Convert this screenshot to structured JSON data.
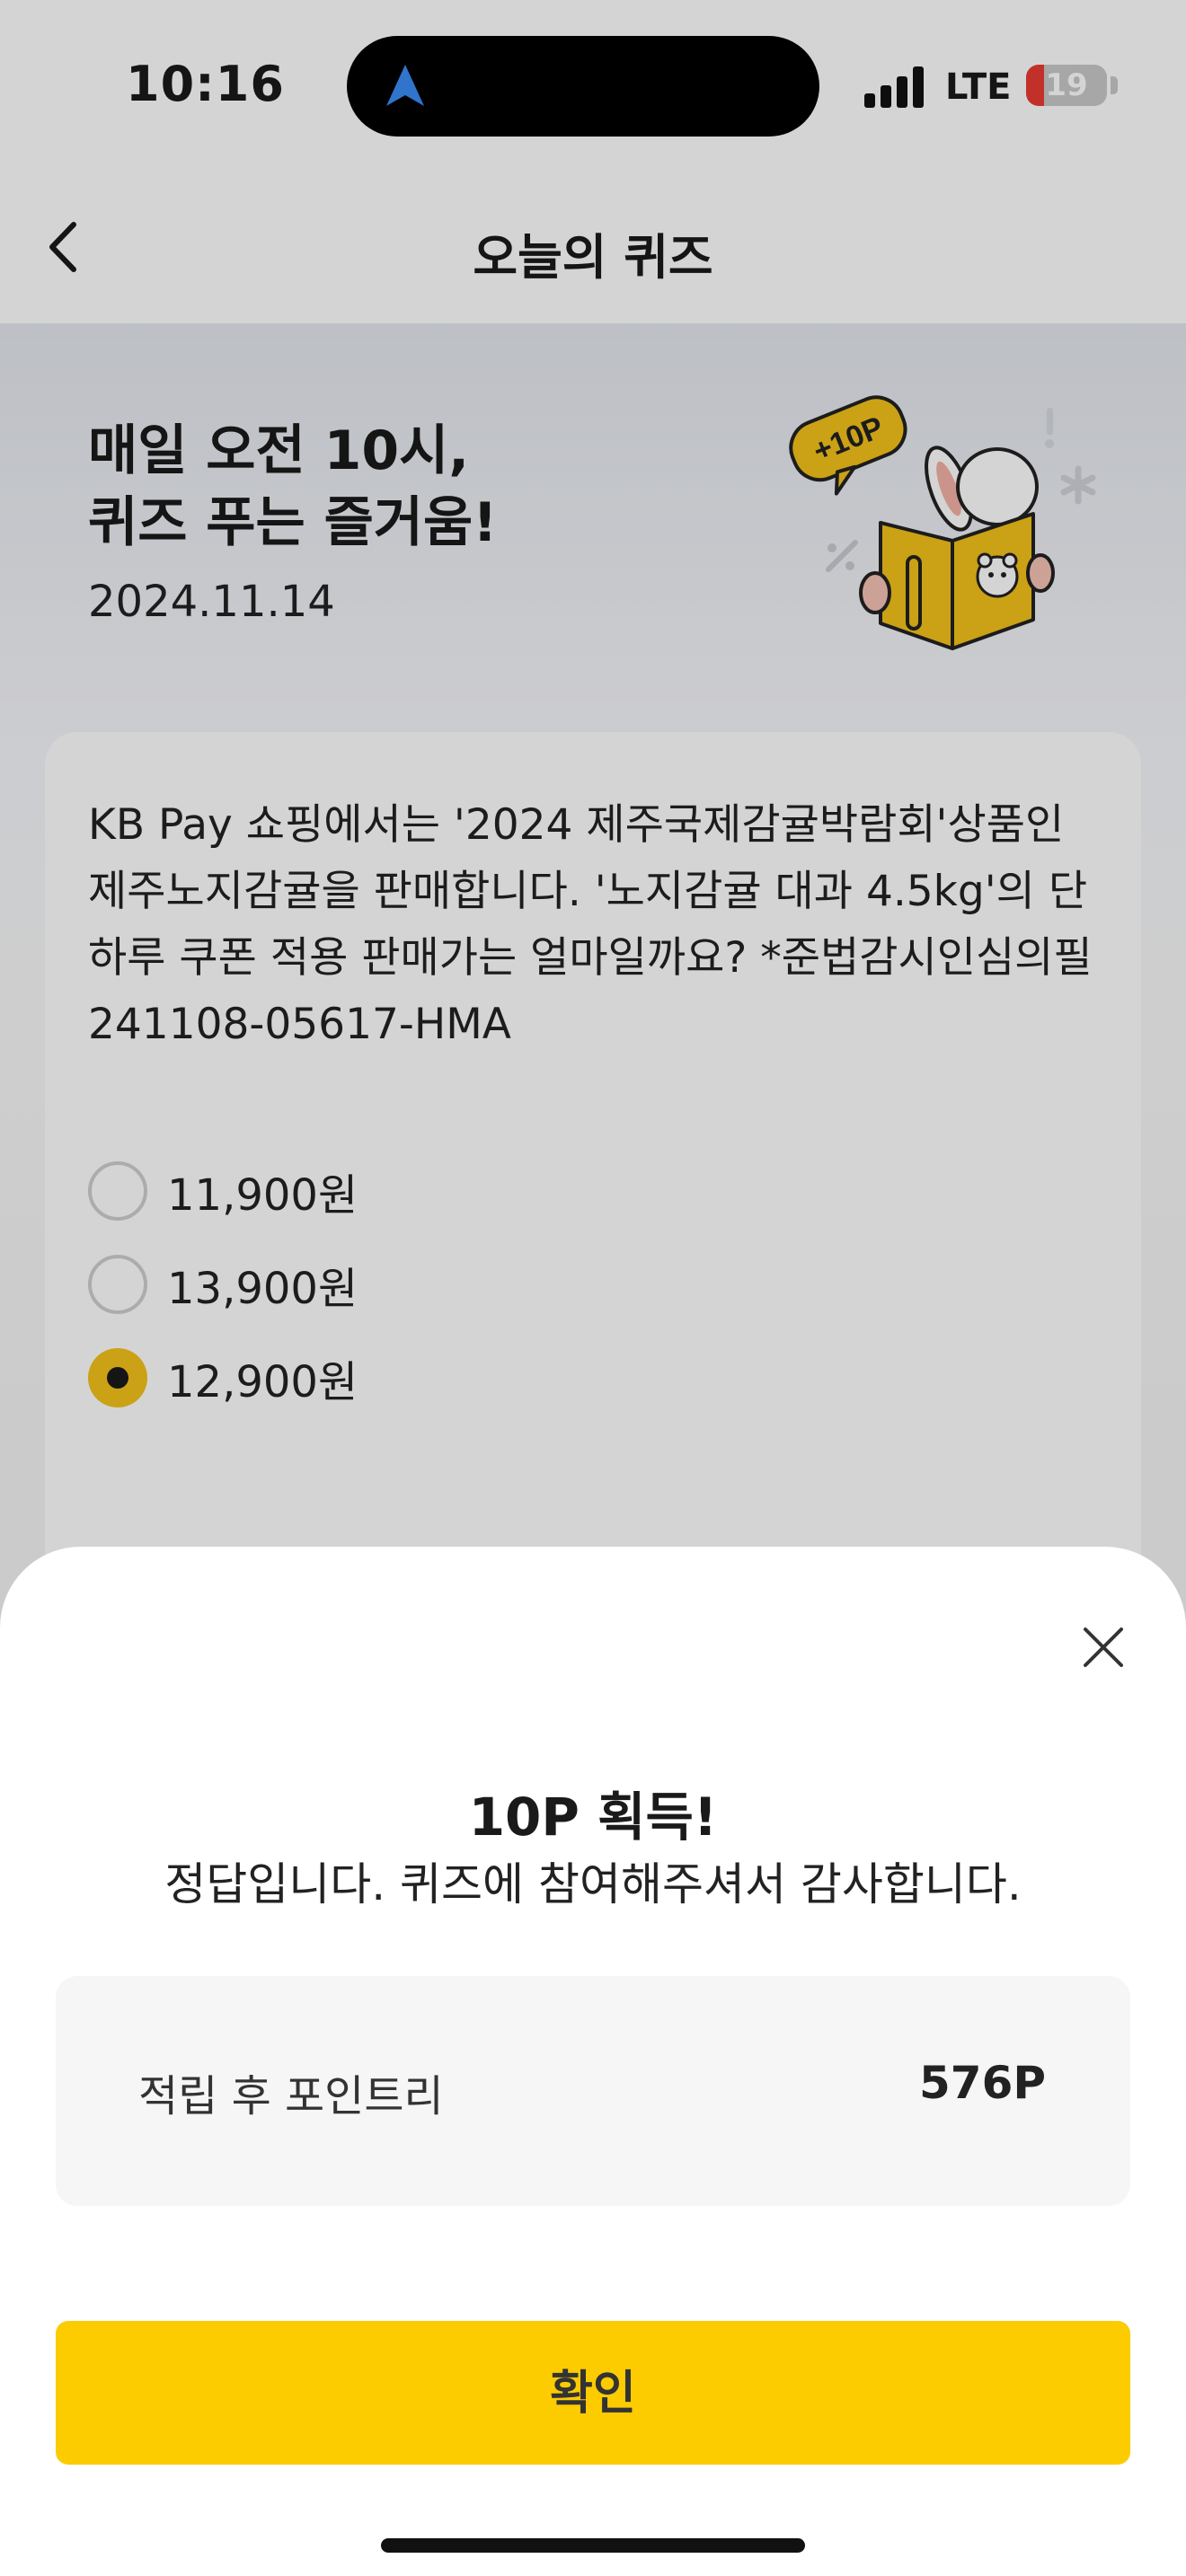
{
  "status_bar": {
    "time": "10:16",
    "network": "LTE",
    "battery": "19"
  },
  "header": {
    "title": "오늘의 퀴즈"
  },
  "banner": {
    "line1": "매일 오전 10시,",
    "line2": "퀴즈 푸는 즐거움!",
    "date": "2024.11.14",
    "badge": "+10P"
  },
  "quiz": {
    "question": "KB Pay 쇼핑에서는 '2024 제주국제감귤박람회'상품인 제주노지감귤을 판매합니다. '노지감귤 대과 4.5kg'의 단 하루 쿠폰 적용 판매가는 얼마일까요? *준법감시인심의필 241108-05617-HMA",
    "options": [
      {
        "label": "11,900원",
        "selected": false
      },
      {
        "label": "13,900원",
        "selected": false
      },
      {
        "label": "12,900원",
        "selected": true
      }
    ]
  },
  "result_sheet": {
    "award": "10P 획득!",
    "message": "정답입니다. 퀴즈에 참여해주셔서 감사합니다.",
    "points_label": "적립 후 포인트리",
    "points_value": "576P",
    "confirm_label": "확인"
  },
  "colors": {
    "accent": "#fccb00",
    "selected_radio": "#f5c21a"
  },
  "icons": [
    "back-chevron-icon",
    "location-arrow-icon",
    "signal-icon",
    "battery-icon",
    "close-icon"
  ]
}
